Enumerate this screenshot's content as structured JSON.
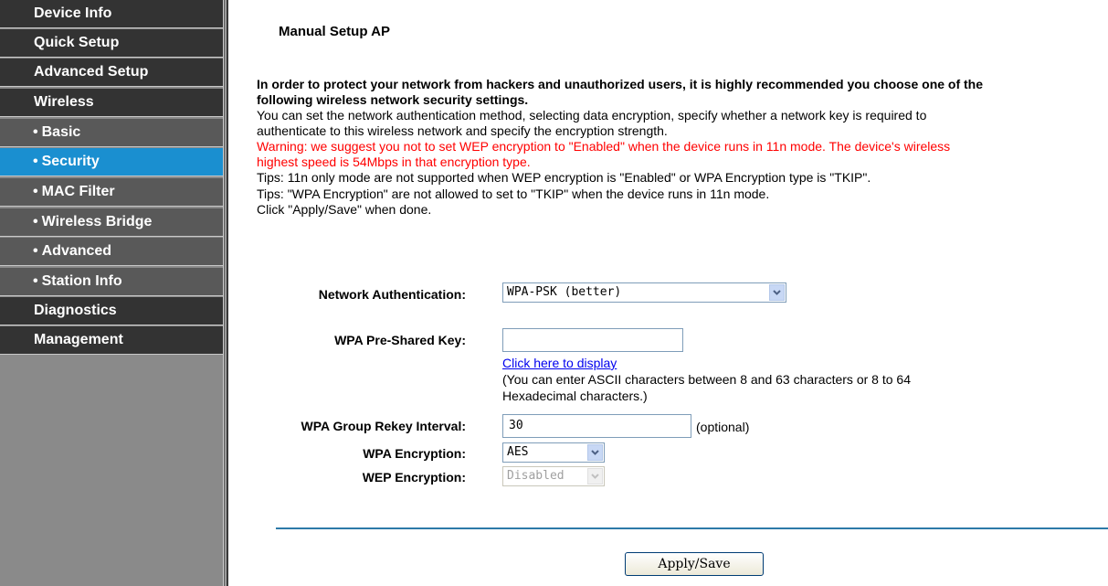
{
  "sidebar": {
    "items": [
      {
        "label": "Device Info",
        "level": "top",
        "active": false
      },
      {
        "label": "Quick Setup",
        "level": "top",
        "active": false
      },
      {
        "label": "Advanced Setup",
        "level": "top",
        "active": false
      },
      {
        "label": "Wireless",
        "level": "top",
        "active": false
      },
      {
        "label": "Basic",
        "level": "sub",
        "active": false
      },
      {
        "label": "Security",
        "level": "sub",
        "active": true
      },
      {
        "label": "MAC Filter",
        "level": "sub",
        "active": false
      },
      {
        "label": "Wireless Bridge",
        "level": "sub",
        "active": false
      },
      {
        "label": "Advanced",
        "level": "sub",
        "active": false
      },
      {
        "label": "Station Info",
        "level": "sub",
        "active": false
      },
      {
        "label": "Diagnostics",
        "level": "top",
        "active": false
      },
      {
        "label": "Management",
        "level": "top",
        "active": false
      }
    ],
    "bullet": "•"
  },
  "main": {
    "title": "Manual Setup AP",
    "intro_bold_1": "In order to protect your network from hackers and unauthorized users, it is highly recommended you choose one of the",
    "intro_bold_2": "following wireless network security settings.",
    "intro_1": "You can set the network authentication method, selecting data encryption, specify whether a network key is required to",
    "intro_2": "authenticate to this wireless network and specify the encryption strength.",
    "warning_1": "Warning: we suggest you not to set WEP encryption to \"Enabled\" when the device runs in 11n mode. The device's wireless",
    "warning_2": "highest speed is 54Mbps in that encryption type.",
    "tip_1": "Tips: 11n only mode are not supported when WEP encryption is \"Enabled\" or WPA Encryption type is \"TKIP\".",
    "tip_2": "Tips: \"WPA Encryption\" are not allowed to set to \"TKIP\" when the device runs in 11n mode.",
    "done_hint": "Click \"Apply/Save\" when done."
  },
  "form": {
    "network_auth": {
      "label": "Network Authentication:",
      "value": "WPA-PSK (better)"
    },
    "psk": {
      "label": "WPA Pre-Shared Key:",
      "value": "",
      "display_link": "Click here to display",
      "hint_1": "(You can enter ASCII characters between 8 and 63 characters or 8 to 64",
      "hint_2": "Hexadecimal characters.)"
    },
    "rekey": {
      "label": "WPA Group Rekey Interval:",
      "value": "30",
      "suffix": "(optional)"
    },
    "wpa_encryption": {
      "label": "WPA Encryption:",
      "value": "AES"
    },
    "wep_encryption": {
      "label": "WEP Encryption:",
      "value": "Disabled",
      "disabled": true
    }
  },
  "apply_label": "Apply/Save",
  "colors": {
    "active_nav": "#1a8fd0",
    "top_nav": "#333333",
    "sub_nav": "#595959",
    "warning": "#ff0000",
    "divider": "#2d7aa8"
  }
}
